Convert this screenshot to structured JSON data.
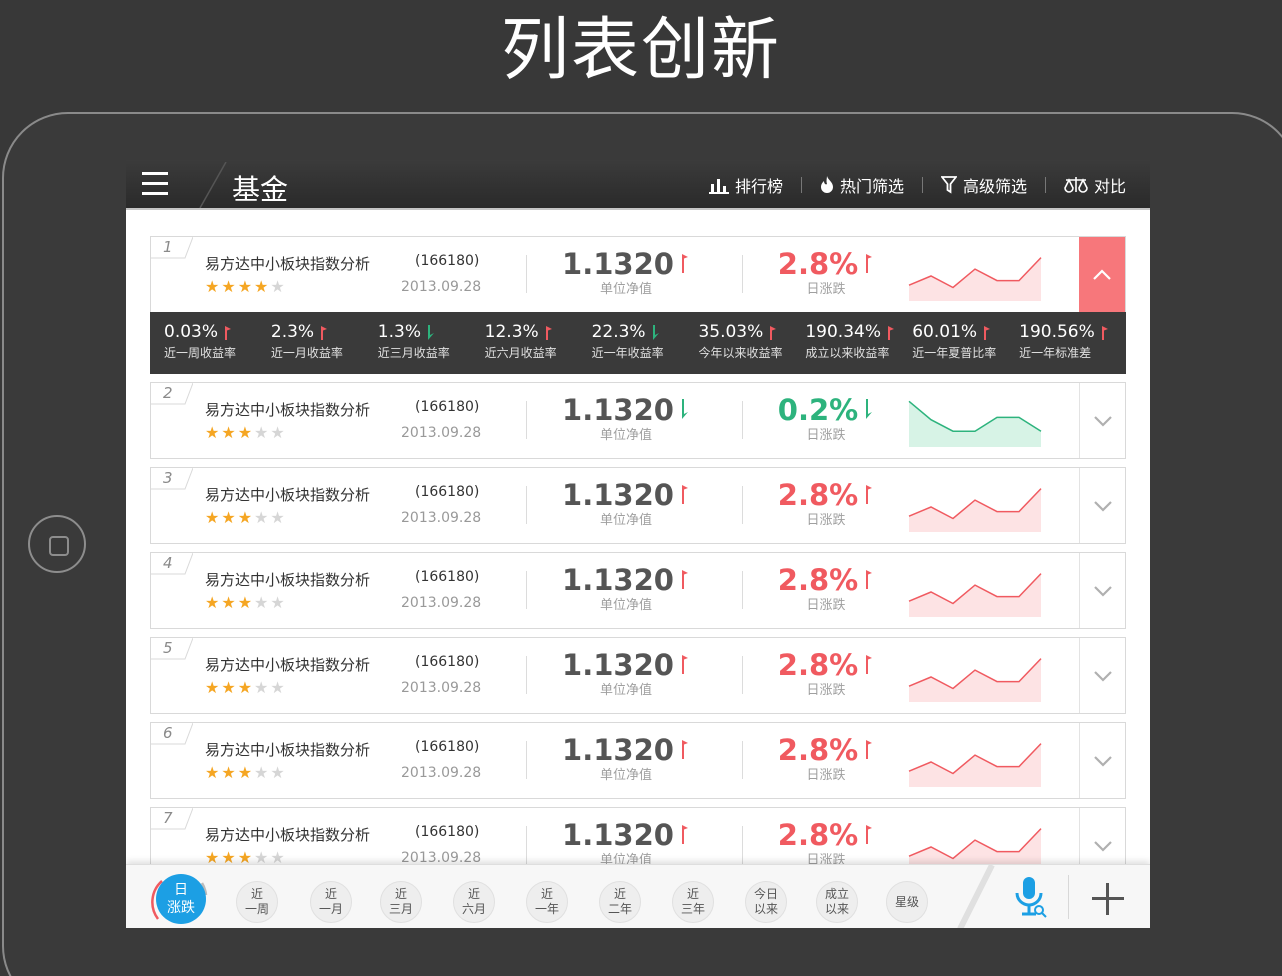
{
  "heading": "列表创新",
  "app": {
    "title": "基金",
    "tools": [
      {
        "label": "排行榜",
        "icon": "bar-chart-icon"
      },
      {
        "label": "热门筛选",
        "icon": "flame-icon"
      },
      {
        "label": "高级筛选",
        "icon": "filter-icon"
      },
      {
        "label": "对比",
        "icon": "scale-icon"
      }
    ]
  },
  "colors": {
    "up": "#f05a60",
    "down": "#2db37d",
    "accent": "#1c9fe4",
    "expanded": "#f7777b"
  },
  "labels": {
    "nav": "单位净值",
    "change": "日涨跌"
  },
  "funds": [
    {
      "rank": "1",
      "name": "易方达中小板块指数分析",
      "code": "(166180)",
      "date": "2013.09.28",
      "stars": 4,
      "nav": "1.1320",
      "nav_dir": "up",
      "change": "2.8%",
      "change_dir": "up",
      "spark": [
        0.3,
        0.5,
        0.25,
        0.65,
        0.4,
        0.4,
        0.9
      ],
      "expanded": true
    },
    {
      "rank": "2",
      "name": "易方达中小板块指数分析",
      "code": "(166180)",
      "date": "2013.09.28",
      "stars": 3,
      "nav": "1.1320",
      "nav_dir": "down",
      "change": "0.2%",
      "change_dir": "down",
      "spark": [
        0.95,
        0.55,
        0.3,
        0.3,
        0.6,
        0.6,
        0.3
      ],
      "expanded": false
    },
    {
      "rank": "3",
      "name": "易方达中小板块指数分析",
      "code": "(166180)",
      "date": "2013.09.28",
      "stars": 3,
      "nav": "1.1320",
      "nav_dir": "up",
      "change": "2.8%",
      "change_dir": "up",
      "spark": [
        0.3,
        0.5,
        0.25,
        0.65,
        0.4,
        0.4,
        0.9
      ],
      "expanded": false
    },
    {
      "rank": "4",
      "name": "易方达中小板块指数分析",
      "code": "(166180)",
      "date": "2013.09.28",
      "stars": 3,
      "nav": "1.1320",
      "nav_dir": "up",
      "change": "2.8%",
      "change_dir": "up",
      "spark": [
        0.3,
        0.5,
        0.25,
        0.65,
        0.4,
        0.4,
        0.9
      ],
      "expanded": false
    },
    {
      "rank": "5",
      "name": "易方达中小板块指数分析",
      "code": "(166180)",
      "date": "2013.09.28",
      "stars": 3,
      "nav": "1.1320",
      "nav_dir": "up",
      "change": "2.8%",
      "change_dir": "up",
      "spark": [
        0.3,
        0.5,
        0.25,
        0.65,
        0.4,
        0.4,
        0.9
      ],
      "expanded": false
    },
    {
      "rank": "6",
      "name": "易方达中小板块指数分析",
      "code": "(166180)",
      "date": "2013.09.28",
      "stars": 3,
      "nav": "1.1320",
      "nav_dir": "up",
      "change": "2.8%",
      "change_dir": "up",
      "spark": [
        0.3,
        0.5,
        0.25,
        0.65,
        0.4,
        0.4,
        0.9
      ],
      "expanded": false
    },
    {
      "rank": "7",
      "name": "易方达中小板块指数分析",
      "code": "(166180)",
      "date": "2013.09.28",
      "stars": 3,
      "nav": "1.1320",
      "nav_dir": "up",
      "change": "2.8%",
      "change_dir": "up",
      "spark": [
        0.3,
        0.5,
        0.25,
        0.65,
        0.4,
        0.4,
        0.9
      ],
      "expanded": false
    }
  ],
  "stats": [
    {
      "value": "0.03%",
      "dir": "up",
      "label": "近一周收益率"
    },
    {
      "value": "2.3%",
      "dir": "up",
      "label": "近一月收益率"
    },
    {
      "value": "1.3%",
      "dir": "down",
      "label": "近三月收益率"
    },
    {
      "value": "12.3%",
      "dir": "up",
      "label": "近六月收益率"
    },
    {
      "value": "22.3%",
      "dir": "down",
      "label": "近一年收益率"
    },
    {
      "value": "35.03%",
      "dir": "up",
      "label": "今年以来收益率"
    },
    {
      "value": "190.34%",
      "dir": "up",
      "label": "成立以来收益率"
    },
    {
      "value": "60.01%",
      "dir": "up",
      "label": "近一年夏普比率"
    },
    {
      "value": "190.56%",
      "dir": "up",
      "label": "近一年标准差"
    }
  ],
  "periods": [
    "日\n涨跌",
    "近\n一周",
    "近\n一月",
    "近\n三月",
    "近\n六月",
    "近\n一年",
    "近\n二年",
    "近\n三年",
    "今日\n以来",
    "成立\n以来",
    "星级"
  ]
}
